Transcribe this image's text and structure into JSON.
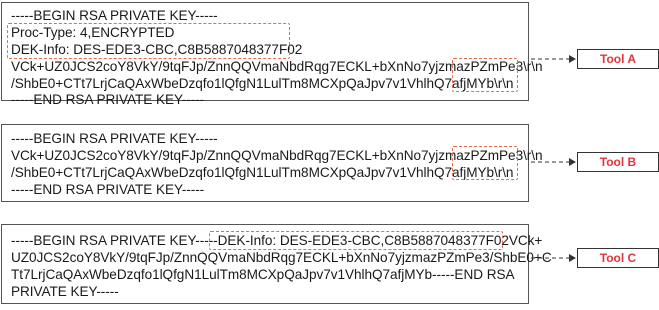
{
  "panel_a": {
    "lines": [
      "-----BEGIN RSA PRIVATE KEY-----",
      "Proc-Type: 4,ENCRYPTED",
      "DEK-Info: DES-EDE3-CBC,C8B5887048377F02",
      "VCk+UZ0JCS2coY8VkY/9tqFJp/ZnnQQVmaNbdRqg7ECKL+bXnNo7yjzmazPZmPe3\\r\\n",
      "/ShbE0+CTt7LrjCaQAxWbeDzqfo1lQfgN1LulTm8MCXpQaJpv7v1VhlhQ7afjMYb\\r\\n",
      "-----END RSA PRIVATE KEY-----"
    ],
    "tool_label": "Tool A"
  },
  "panel_b": {
    "lines": [
      "-----BEGIN RSA PRIVATE KEY-----",
      "VCk+UZ0JCS2coY8VkY/9tqFJp/ZnnQQVmaNbdRqg7ECKL+bXnNo7yjzmazPZmPe3\\r\\n",
      "/ShbE0+CTt7LrjCaQAxWbeDzqfo1lQfgN1LulTm8MCXpQaJpv7v1VhlhQ7afjMYb\\r\\n",
      "-----END RSA PRIVATE KEY-----"
    ],
    "tool_label": "Tool B"
  },
  "panel_c": {
    "lines": [
      "-----BEGIN RSA PRIVATE KEY-----DEK-Info: DES-EDE3-CBC,C8B5887048377F02VCk+",
      "UZ0JCS2coY8VkY/9tqFJp/ZnnQQVmaNbdRqg7ECKL+bXnNo7yjzmazPZmPe3/ShbE0+C",
      "Tt7LrjCaQAxWbeDzqfo1lQfgN1LulTm8MCXpQaJpv7v1VhlhQ7afjMYb-----END RSA",
      "PRIVATE KEY-----"
    ],
    "tool_label": "Tool C"
  },
  "colors": {
    "highlight_dash": "#e36c4b",
    "tool_label": "#e0353b",
    "border": "#555555"
  }
}
